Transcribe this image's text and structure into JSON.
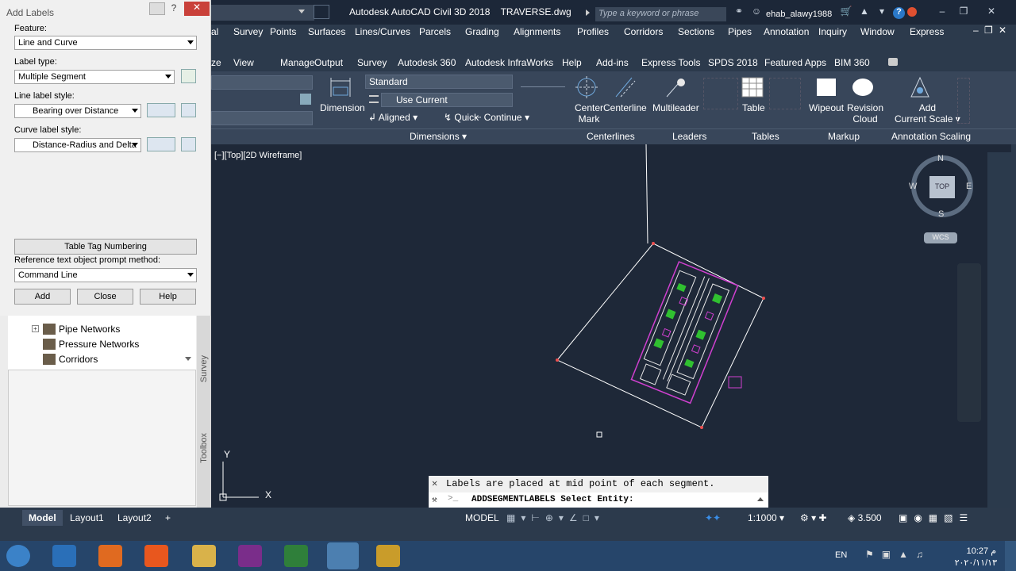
{
  "titlebar": {
    "app": "Autodesk AutoCAD Civil 3D 2018",
    "file": "TRAVERSE.dwg",
    "search_placeholder": "Type a keyword or phrase",
    "user": "ehab_alawy1988"
  },
  "menu": [
    "Survey",
    "Points",
    "Surfaces",
    "Lines/Curves",
    "Parcels",
    "Grading",
    "Alignments",
    "Profiles",
    "Corridors",
    "Sections",
    "Pipes",
    "Annotation",
    "Inquiry",
    "Window",
    "Express"
  ],
  "menu_left_cut": "al",
  "tabs": [
    "View",
    "Manage",
    "Output",
    "Survey",
    "Autodesk 360",
    "Autodesk InfraWorks",
    "Help",
    "Add-ins",
    "Express Tools",
    "SPDS 2018",
    "Featured Apps",
    "BIM 360"
  ],
  "tabs_left_cut": "ze",
  "ribbon": {
    "dim_style": "Standard",
    "layer": "Use Current",
    "dimension": "Dimension",
    "aligned": "Aligned",
    "quick": "Quick",
    "continue": "Continue",
    "center_mark": [
      "Center",
      "Mark"
    ],
    "centerline": "Centerline",
    "multileader": "Multileader",
    "table": "Table",
    "wipeout": "Wipeout",
    "revision_cloud": [
      "Revision",
      "Cloud"
    ],
    "add_scale": [
      "Add",
      "Current Scale"
    ],
    "panels": [
      "Dimensions",
      "Centerlines",
      "Leaders",
      "Tables",
      "Markup",
      "Annotation Scaling"
    ]
  },
  "viewport_label": "[−][Top][2D Wireframe]",
  "viewcube": {
    "n": "N",
    "s": "S",
    "e": "E",
    "w": "W",
    "top": "TOP",
    "wcs": "WCS"
  },
  "dialog": {
    "title": "Add Labels",
    "feature_label": "Feature:",
    "feature": "Line and Curve",
    "label_type_label": "Label type:",
    "label_type": "Multiple Segment",
    "line_style_label": "Line label style:",
    "line_style": "Bearing over Distance",
    "curve_style_label": "Curve label style:",
    "curve_style": "Distance-Radius and Delta",
    "table_tag": "Table Tag Numbering",
    "prompt_label": "Reference text object prompt method:",
    "prompt": "Command Line",
    "add": "Add",
    "close": "Close",
    "help": "Help"
  },
  "tree": [
    "Pipe Networks",
    "Pressure Networks",
    "Corridors"
  ],
  "side_tabs": [
    "Survey",
    "Toolbox"
  ],
  "command": {
    "history": "Labels are placed at mid point of each segment.",
    "line": "ADDSEGMENTLABELS Select Entity:"
  },
  "layouts": [
    "Model",
    "Layout1",
    "Layout2"
  ],
  "status": {
    "model": "MODEL",
    "scale": "1:1000",
    "lineweight": "3.500"
  },
  "taskbar": {
    "lang": "EN",
    "time": "10:27 م",
    "date": "٢٠٢٠/١١/١٣"
  },
  "colors": {
    "magenta": "#d040d0",
    "green": "#30c030",
    "accent": "#0a64c8"
  }
}
